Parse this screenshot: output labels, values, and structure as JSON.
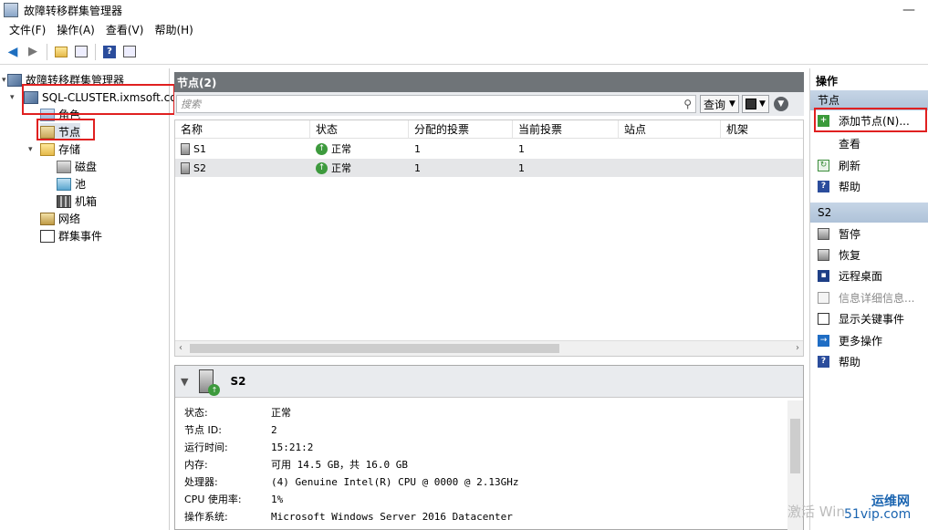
{
  "window": {
    "title": "故障转移群集管理器"
  },
  "menu": [
    "文件(F)",
    "操作(A)",
    "查看(V)",
    "帮助(H)"
  ],
  "tree": {
    "root": "故障转移群集管理器",
    "cluster": "SQL-CLUSTER.ixmsoft.com",
    "roles": "角色",
    "nodes": "节点",
    "storage": "存储",
    "disks": "磁盘",
    "pools": "池",
    "enclosures": "机箱",
    "networks": "网络",
    "cluster_events": "群集事件"
  },
  "center": {
    "header": "节点(2)",
    "search_placeholder": "搜索",
    "query_label": "查询",
    "columns": [
      "名称",
      "状态",
      "分配的投票",
      "当前投票",
      "站点",
      "机架"
    ],
    "rows": [
      {
        "name": "S1",
        "status": "正常",
        "assigned_vote": "1",
        "current_vote": "1"
      },
      {
        "name": "S2",
        "status": "正常",
        "assigned_vote": "1",
        "current_vote": "1"
      }
    ]
  },
  "detail": {
    "name": "S2",
    "props": [
      {
        "k": "状态:",
        "v": "正常"
      },
      {
        "k": "节点 ID:",
        "v": "2"
      },
      {
        "k": "运行时间:",
        "v": "15:21:2"
      },
      {
        "k": "内存:",
        "v": "可用 14.5 GB，共 16.0 GB"
      },
      {
        "k": "处理器:",
        "v": "(4) Genuine Intel(R) CPU          @ 0000 @ 2.13GHz"
      },
      {
        "k": "CPU 使用率:",
        "v": "1%"
      },
      {
        "k": "操作系统:",
        "v": "Microsoft Windows Server 2016 Datacenter"
      }
    ]
  },
  "actions": {
    "title": "操作",
    "section1": "节点",
    "items1": [
      "添加节点(N)...",
      "查看",
      "刷新",
      "帮助"
    ],
    "section2": "S2",
    "items2": [
      "暂停",
      "恢复",
      "远程桌面",
      "信息详细信息...",
      "显示关键事件",
      "更多操作",
      "帮助"
    ]
  },
  "watermark": {
    "brand": "运维网",
    "sub": "51vip.com",
    "left_text": "激活 Win"
  }
}
